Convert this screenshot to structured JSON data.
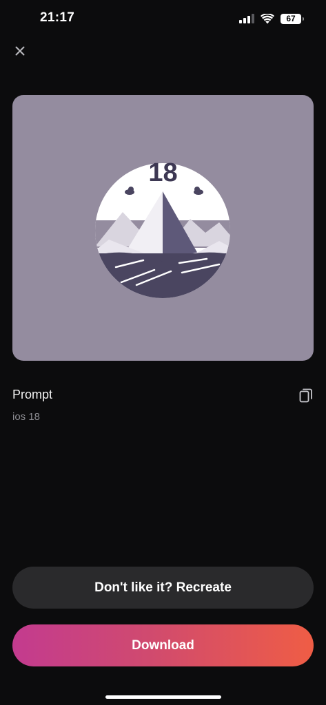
{
  "status_bar": {
    "time": "21:17",
    "battery": "67",
    "icons": [
      "signal-icon",
      "wifi-icon",
      "battery-icon"
    ]
  },
  "header": {
    "close_icon": "close-icon"
  },
  "image": {
    "badge_number": "18",
    "background_color": "#948c9f"
  },
  "prompt": {
    "title": "Prompt",
    "text": "ios 18",
    "copy_icon": "copy-icon"
  },
  "actions": {
    "recreate_label": "Don't like it? Recreate",
    "download_label": "Download",
    "download_gradient": [
      "#c33b8f",
      "#ef5d45"
    ]
  }
}
